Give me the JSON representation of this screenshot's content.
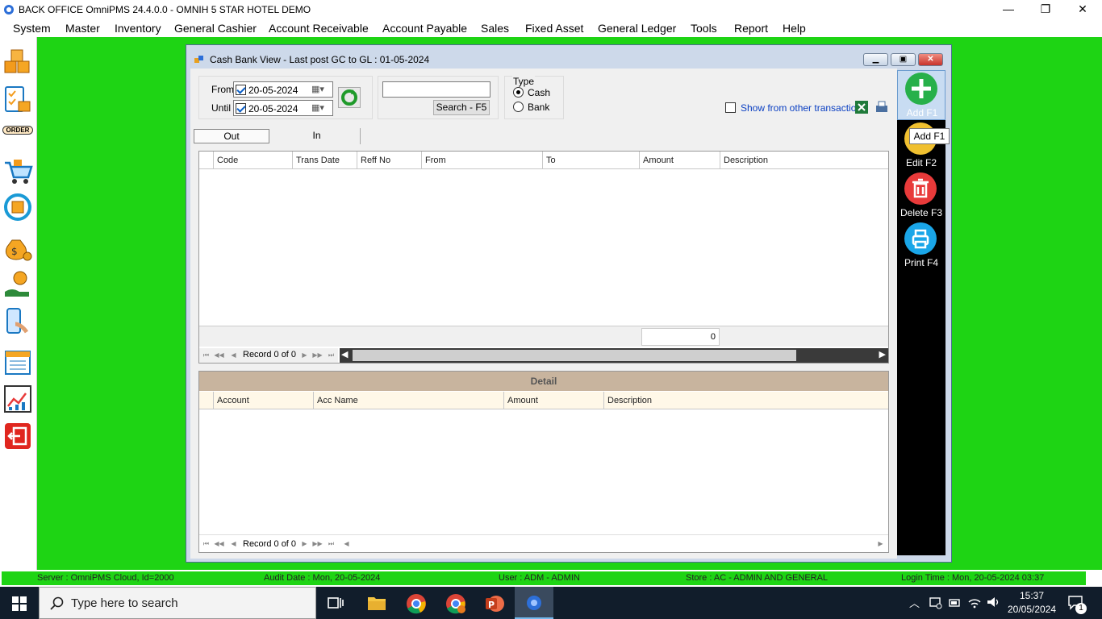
{
  "window": {
    "title": "BACK OFFICE OmniPMS 24.4.0.0 - OMNIH 5 STAR HOTEL DEMO",
    "minimize": "—",
    "maximize": "❐",
    "close": "✕"
  },
  "menu": [
    "System",
    "Master",
    "Inventory",
    "General Cashier",
    "Account Receivable",
    "Account Payable",
    "Sales",
    "Fixed Asset",
    "General Ledger",
    "Tools",
    "Report",
    "Help"
  ],
  "sidebar_icons": [
    "boxes-icon",
    "checklist-box-icon",
    "order-icon",
    "shopping-cart-icon",
    "refresh-box-icon",
    "money-bag-icon",
    "hand-money-icon",
    "phone-payment-icon",
    "calendar-book-icon",
    "chart-report-icon",
    "exit-icon"
  ],
  "sidebar_order_label": "ORDER",
  "child": {
    "title": "Cash Bank View - Last post GC to GL : 01-05-2024",
    "from_label": "From",
    "until_label": "Until",
    "from_date": "20-05-2024",
    "until_date": "20-05-2024",
    "search_value": "",
    "search_button": "Search - F5",
    "type_label": "Type",
    "type_cash": "Cash",
    "type_bank": "Bank",
    "type_selected": "Cash",
    "show_other": "Show from other transaction",
    "tabs": [
      "Out",
      "In"
    ],
    "active_tab": "Out",
    "columns": [
      "Code",
      "Trans Date",
      "Reff No",
      "From",
      "To",
      "Amount",
      "Description"
    ],
    "amount_total": "0",
    "record_text": "Record 0 of 0",
    "detail_title": "Detail",
    "detail_columns": [
      "Account",
      "Acc Name",
      "Amount",
      "Description"
    ],
    "detail_record_text": "Record 0 of 0"
  },
  "actions": {
    "add": "Add F1",
    "edit": "Edit F2",
    "delete": "Delete F3",
    "print": "Print F4",
    "tooltip": "Add F1"
  },
  "status": {
    "server": "Server : OmniPMS Cloud, Id=2000",
    "audit": "Audit Date : Mon, 20-05-2024",
    "user": "User : ADM - ADMIN",
    "store": "Store : AC - ADMIN AND GENERAL",
    "login": "Login Time : Mon, 20-05-2024 03:37"
  },
  "taskbar": {
    "search_placeholder": "Type here to search",
    "time": "15:37",
    "date": "20/05/2024",
    "notif_count": "1"
  },
  "colors": {
    "desktop": "#1ed414",
    "add": "#27b04a",
    "edit": "#f0c030",
    "delete": "#e83a3a",
    "print": "#1aa6e8"
  }
}
